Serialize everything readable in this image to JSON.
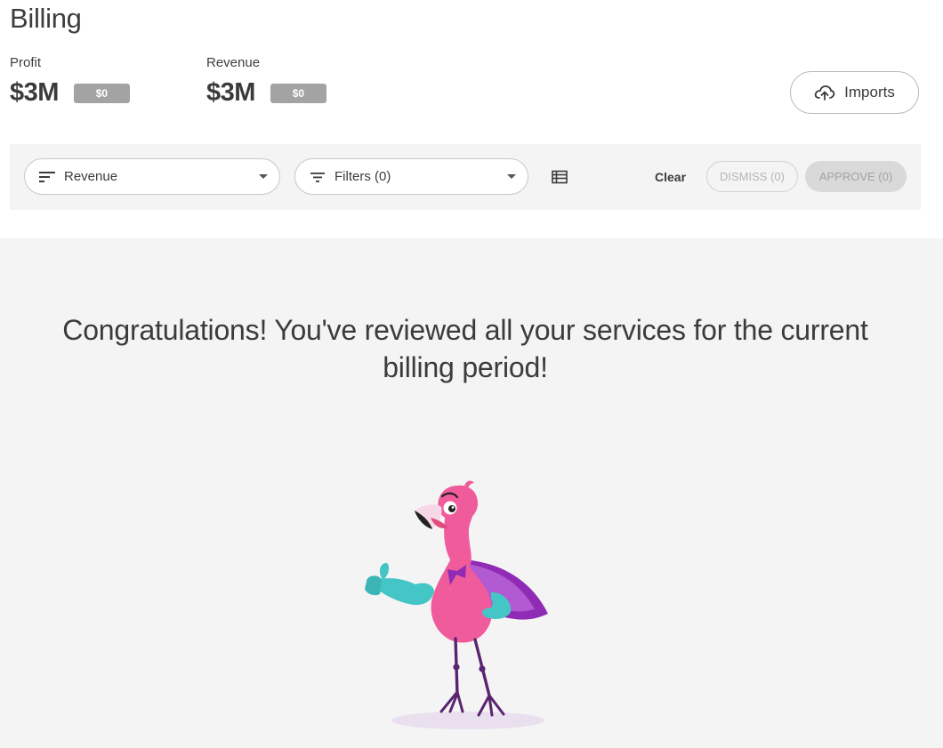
{
  "page": {
    "title": "Billing"
  },
  "metrics": [
    {
      "label": "Profit",
      "value": "$3M",
      "badge": "$0"
    },
    {
      "label": "Revenue",
      "value": "$3M",
      "badge": "$0"
    }
  ],
  "imports": {
    "label": "Imports",
    "icon": "cloud-upload-icon"
  },
  "toolbar": {
    "sort": {
      "value": "Revenue",
      "icon": "sort-lines-icon"
    },
    "filter": {
      "value": "Filters (0)",
      "icon": "filter-icon"
    },
    "view_icon": "table-view-icon",
    "clear": "Clear",
    "dismiss": "DISMISS (0)",
    "approve": "APPROVE (0)"
  },
  "empty_state": {
    "message_line1": "Congratulations! You've reviewed all your services for the current",
    "message_line2": "billing period!",
    "illustration": "flamingo-thumbs-up-illustration"
  },
  "colors": {
    "panel": "#f4f4f4",
    "badge": "#a3a3a3",
    "mascot_pink": "#f05b9c",
    "cape_purple": "#8e24aa",
    "wing_teal": "#43c6c5"
  }
}
